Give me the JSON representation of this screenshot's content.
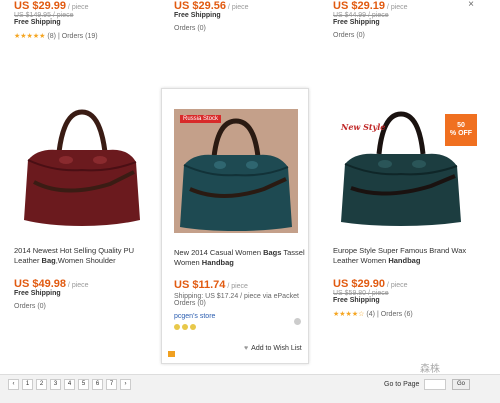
{
  "top_row": [
    {
      "price": "US $29.99",
      "per": " / piece",
      "old_price": "US $149.95 / piece",
      "shipping": "Free Shipping",
      "stars": "★★★★★",
      "rating_count": "(8)",
      "orders": "Orders (19)"
    },
    {
      "price": "US $29.56",
      "per": " / piece",
      "shipping": "Free Shipping",
      "orders": "Orders (0)"
    },
    {
      "price": "US $29.19",
      "per": " / piece",
      "old_price": "US $44.99 / piece",
      "shipping": "Free Shipping",
      "orders": "Orders (0)"
    }
  ],
  "close_label": "×",
  "products": [
    {
      "title_plain_1": "2014 Newest Hot Selling Quality PU Leather ",
      "title_bold_1": "Bag",
      "title_plain_2": ",Women Shoulder",
      "price": "US $49.98",
      "per": " / piece",
      "shipping": "Free Shipping",
      "orders": "Orders (0)",
      "bag_color": "#6b1a1e"
    },
    {
      "badge": "Russia Stock",
      "title_plain_1": "New 2014 Casual Women ",
      "title_bold_1": "Bags",
      "title_plain_2": " Tassel Women ",
      "title_bold_2": "Handbag",
      "price": "US $11.74",
      "per": " / piece",
      "shipping_line": "Shipping: US $17.24 / piece via ePacket",
      "orders": "Orders (0)",
      "store": "pcgen's store",
      "wishlist": "Add to Wish List",
      "bag_color": "#1e4a52"
    },
    {
      "badge": "New Style",
      "discount_1": "50",
      "discount_2": "% OFF",
      "title_plain_1": "Europe Style Super Famous Brand Wax Leather Women ",
      "title_bold_1": "Handbag",
      "price": "US $29.90",
      "per": " / piece",
      "old_price": "US $59.80 / piece",
      "shipping": "Free Shipping",
      "stars": "★★★★☆",
      "rating_count": "(4)",
      "orders": "Orders (6)",
      "bag_color": "#1c3d40"
    }
  ],
  "pagination": {
    "prev": "‹",
    "pages": [
      "1",
      "2",
      "3",
      "4",
      "5",
      "6",
      "7"
    ],
    "next": "›",
    "goto_label": "Go to Page",
    "go_button": "Go"
  },
  "watermark": "森株"
}
